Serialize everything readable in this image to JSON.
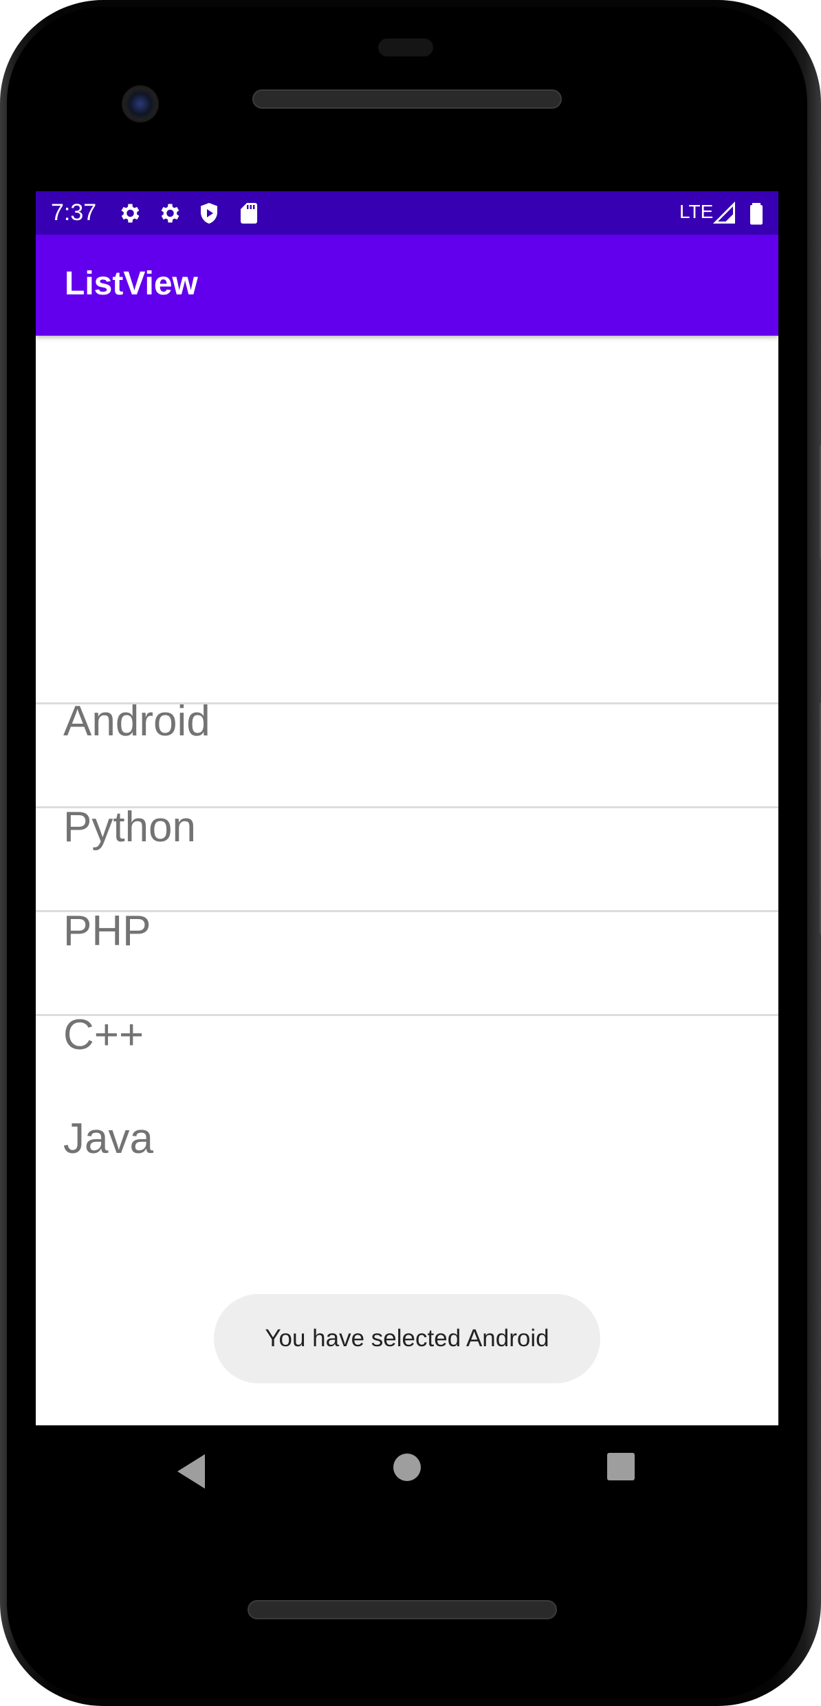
{
  "status_bar": {
    "time": "7:37",
    "icons": [
      "gear-icon",
      "gear-icon",
      "shield-icon",
      "sd-card-icon"
    ],
    "network": "LTE",
    "right_icons": [
      "signal-icon",
      "battery-icon"
    ]
  },
  "app_bar": {
    "title": "ListView"
  },
  "list": {
    "items": [
      "Android",
      "Python",
      "PHP",
      "C++",
      "Java"
    ]
  },
  "toast": {
    "message": "You have selected Android"
  },
  "nav_bar": {
    "buttons": [
      "back-icon",
      "home-icon",
      "recents-icon"
    ]
  },
  "colors": {
    "status_bar": "#3700b3",
    "app_bar": "#6200ee",
    "list_text": "#737373",
    "toast_bg": "#eeeeee"
  }
}
